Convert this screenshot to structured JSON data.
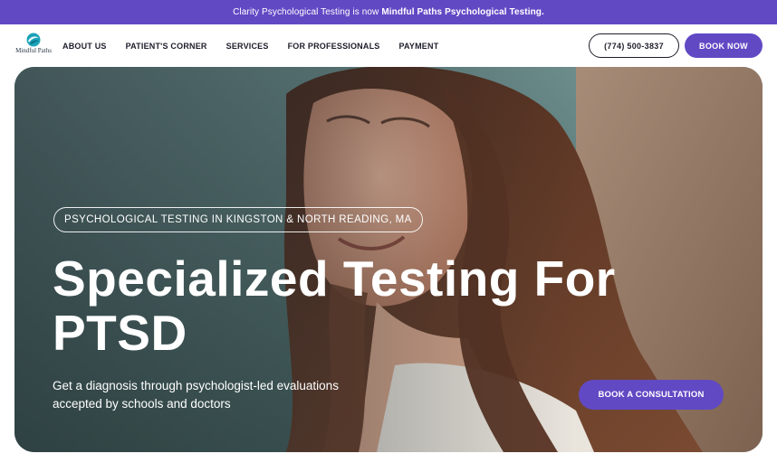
{
  "announcement": {
    "text": "Clarity Psychological Testing is now",
    "highlight": "Mindful Paths Psychological Testing."
  },
  "logo": {
    "name": "Mindful Paths",
    "icon": "mindful-paths-logo-icon"
  },
  "nav": {
    "items": [
      {
        "label": "ABOUT US"
      },
      {
        "label": "PATIENT'S CORNER"
      },
      {
        "label": "SERVICES"
      },
      {
        "label": "FOR PROFESSIONALS"
      },
      {
        "label": "PAYMENT"
      }
    ],
    "phone": "(774) 500-3837",
    "book": "BOOK NOW"
  },
  "hero": {
    "location_pill": "PSYCHOLOGICAL TESTING IN KINGSTON & NORTH READING, MA",
    "headline_line1": "Specialized Testing For",
    "headline_line2": "PTSD",
    "subtitle": "Get a diagnosis through psychologist-led evaluations accepted by schools and doctors",
    "cta": "BOOK A CONSULTATION"
  },
  "colors": {
    "brand": "#6149c4",
    "text": "#1d1d2b",
    "white": "#ffffff"
  }
}
